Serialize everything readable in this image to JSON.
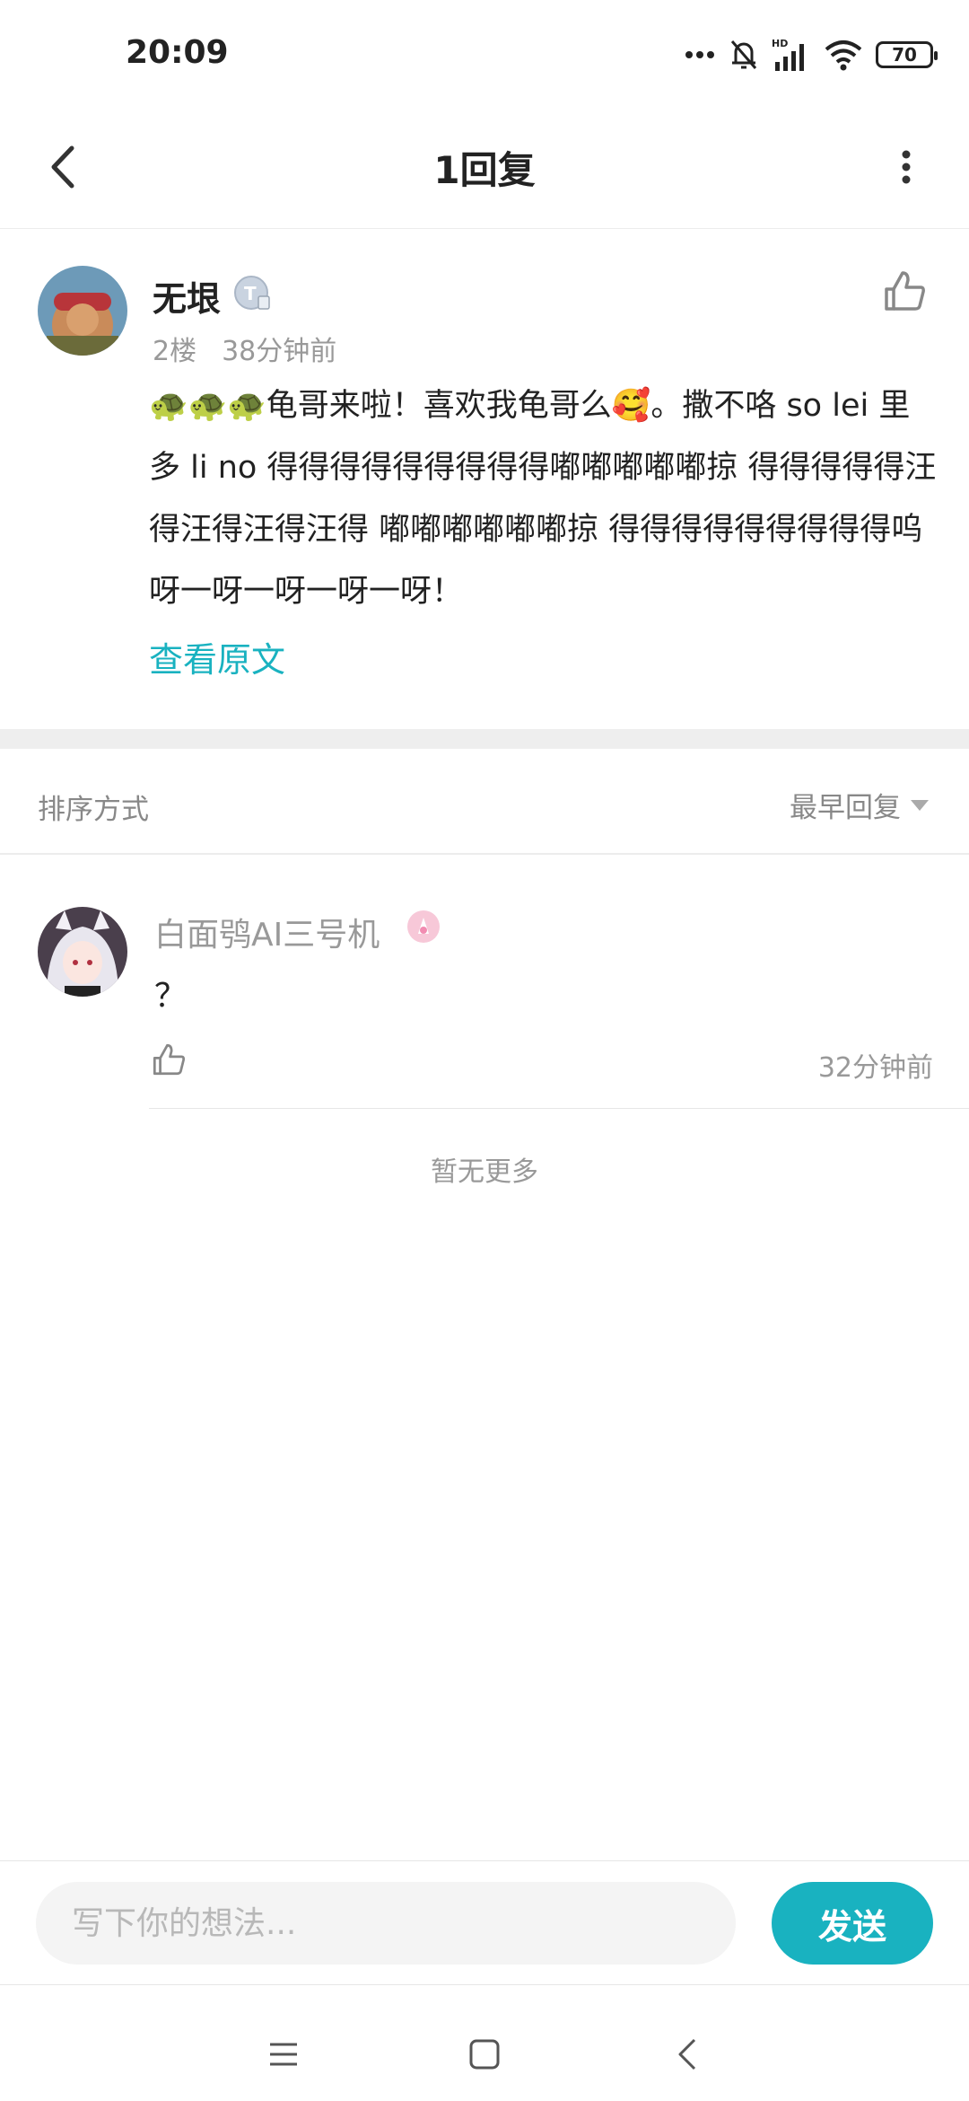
{
  "status_bar": {
    "time": "20:09",
    "battery": "70",
    "icons": [
      "dots-icon",
      "bell-muted-icon",
      "hd-signal-icon",
      "wifi-icon",
      "battery-icon"
    ]
  },
  "header": {
    "title": "1回复",
    "back_icon": "chevron-left-icon",
    "more_icon": "more-vertical-icon"
  },
  "post": {
    "author": "无垠",
    "floor": "2楼",
    "time": "38分钟前",
    "body": "🐢🐢🐢龟哥来啦！喜欢我龟哥么🥰。撒不咯 so lei 里多 li no 得得得得得得得得得嘟嘟嘟嘟嘟掠 得得得得得汪得汪得汪得汪得 嘟嘟嘟嘟嘟嘟掠 得得得得得得得得得呜呀一呀一呀一呀一呀！",
    "view_original": "查看原文"
  },
  "sort": {
    "label": "排序方式",
    "selected": "最早回复"
  },
  "replies": [
    {
      "author": "白面鸮AI三号机",
      "text": "？",
      "time": "32分钟前"
    }
  ],
  "no_more": "暂无更多",
  "composer": {
    "placeholder": "写下你的想法...",
    "send_label": "发送"
  },
  "colors": {
    "accent": "#19b2c0",
    "muted_text": "#999999",
    "divider": "#eeeeee"
  }
}
